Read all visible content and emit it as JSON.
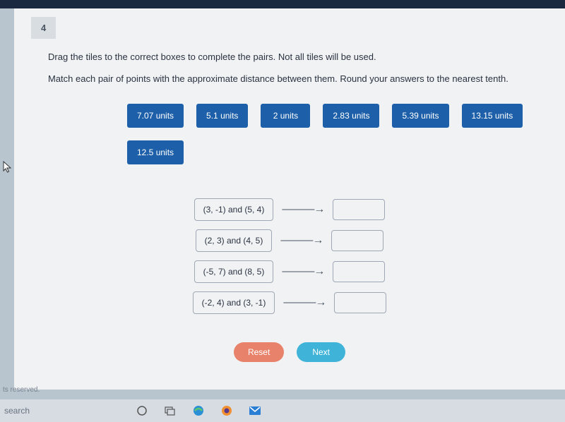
{
  "question": {
    "number": "4",
    "instruction": "Drag the tiles to the correct boxes to complete the pairs. Not all tiles will be used.",
    "sub_instruction": "Match each pair of points with the approximate distance between them. Round your answers to the nearest tenth."
  },
  "tiles": [
    "7.07 units",
    "5.1 units",
    "2 units",
    "2.83 units",
    "5.39 units",
    "13.15 units",
    "12.5 units"
  ],
  "pairs": [
    "(3, -1) and (5, 4)",
    "(2, 3) and (4, 5)",
    "(-5, 7) and (8, 5)",
    "(-2, 4) and (3, -1)"
  ],
  "buttons": {
    "reset": "Reset",
    "next": "Next"
  },
  "footer": {
    "reserved": "ts reserved.",
    "search": "search"
  }
}
